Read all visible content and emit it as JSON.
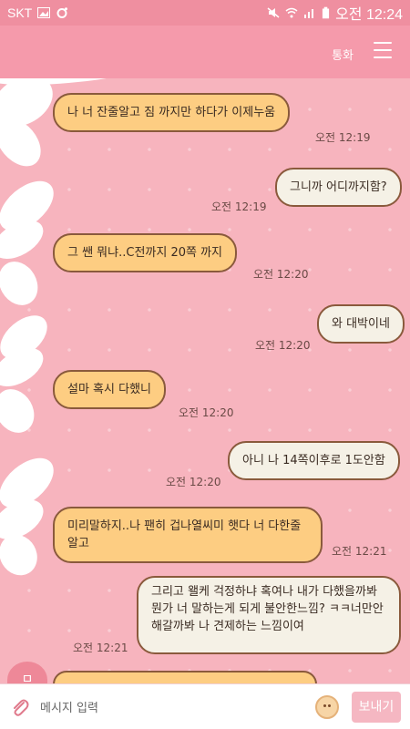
{
  "status_bar": {
    "carrier": "SKT",
    "time": "오전 12:24"
  },
  "header": {
    "call_label": "통화"
  },
  "messages": [
    {
      "dir": "in",
      "text": "나 너 잔줄알고 짐 까지만 하다가 이제누움",
      "time": "오전 12:19"
    },
    {
      "dir": "out",
      "text": "그니까 어디까지함?",
      "time": "오전 12:19"
    },
    {
      "dir": "in",
      "text": "그 쌘 뭐냐..C전까지 20쪽 까지",
      "time": "오전 12:20"
    },
    {
      "dir": "out",
      "text": "와 대박이네",
      "time": "오전 12:20"
    },
    {
      "dir": "in",
      "text": "설마 혹시 다했니",
      "time": "오전 12:20"
    },
    {
      "dir": "out",
      "text": "아니 나 14쪽이후로 1도안함",
      "time": "오전 12:20"
    },
    {
      "dir": "in",
      "text": "미리말하지..나 팬히 겁나열씨미 햇다 너 다한줄알고",
      "time": "오전 12:21"
    },
    {
      "dir": "out",
      "text": "그리고 왤케 걱정하냐 혹여나 내가 다했을까봐 뭔가 너 말하는게 되게 불안한느낌? ㅋㅋ너만안해갈까봐 나 견제하는 느낌이여",
      "time": "오전 12:21"
    }
  ],
  "avatar_peek_label": "ㅁ",
  "input": {
    "placeholder": "메시지 입력",
    "send_label": "보내기"
  },
  "colors": {
    "background": "#f7b4be",
    "header": "#f59aab",
    "incoming_bubble": "#fdcd82",
    "outgoing_bubble": "#f5f1e6",
    "bubble_border": "#8a5a3c"
  }
}
